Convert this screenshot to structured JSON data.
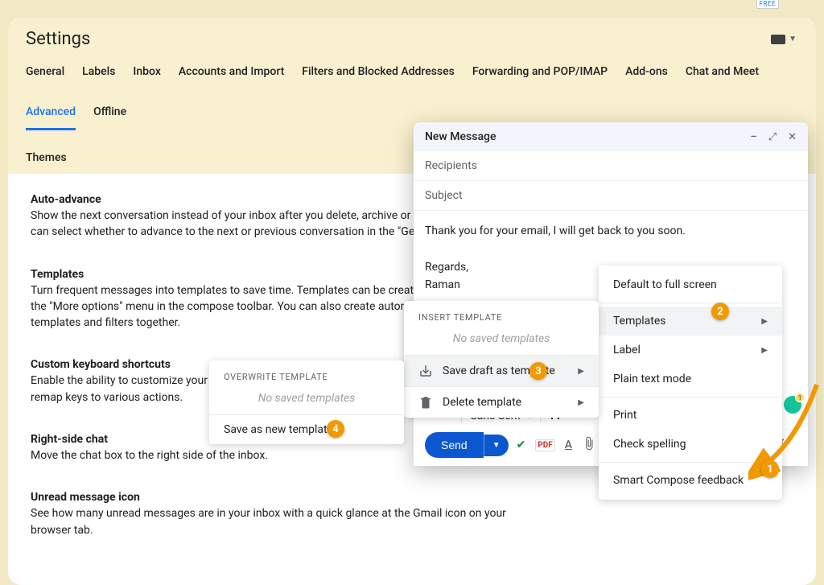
{
  "topbar": {
    "free_badge": "FREE"
  },
  "settings": {
    "title": "Settings",
    "tabs": {
      "general": "General",
      "labels": "Labels",
      "inbox": "Inbox",
      "accounts": "Accounts and Import",
      "filters": "Filters and Blocked Addresses",
      "forwarding": "Forwarding and POP/IMAP",
      "addons": "Add-ons",
      "chat": "Chat and Meet",
      "advanced": "Advanced",
      "offline": "Offline",
      "themes": "Themes"
    },
    "items": {
      "auto_advance": {
        "title": "Auto-advance",
        "desc": "Show the next conversation instead of your inbox after you delete, archive or mute a conversation. You can select whether to advance to the next or previous conversation in the \"General\" Settings page."
      },
      "templates": {
        "title": "Templates",
        "desc": "Turn frequent messages into templates to save time. Templates can be created and inserted through the \"More options\" menu in the compose toolbar. You can also create automatic replies using templates and filters together."
      },
      "custom_shortcuts": {
        "title": "Custom keyboard shortcuts",
        "desc": "Enable the ability to customize your keyboard shortcuts via a new settings tab from which you can remap keys to various actions."
      },
      "right_side_chat": {
        "title": "Right-side chat",
        "desc": "Move the chat box to the right side of the inbox."
      },
      "unread_icon": {
        "title": "Unread message icon",
        "desc": "See how many unread messages are in your inbox with a quick glance at the Gmail icon on your browser tab."
      }
    }
  },
  "compose": {
    "header": "New Message",
    "recipients_placeholder": "Recipients",
    "subject_placeholder": "Subject",
    "body_line1": "Thank you for your email, I will get back to you soon.",
    "body_regards": "Regards,",
    "body_name": "Raman",
    "font": "Sans Serif",
    "send": "Send",
    "pdf_label": "PDF"
  },
  "more_menu": {
    "default_fullscreen": "Default to full screen",
    "templates": "Templates",
    "label": "Label",
    "plain_text": "Plain text mode",
    "print": "Print",
    "check_spelling": "Check spelling",
    "smart_compose": "Smart Compose feedback"
  },
  "templates_submenu": {
    "insert_header": "INSERT TEMPLATE",
    "no_saved": "No saved templates",
    "save_draft": "Save draft as template",
    "delete": "Delete template"
  },
  "overwrite_submenu": {
    "header": "OVERWRITE TEMPLATE",
    "no_saved": "No saved templates",
    "save_new": "Save as new template"
  },
  "annotations": {
    "b1": "1",
    "b2": "2",
    "b3": "3",
    "b4": "4"
  },
  "grammarly_count": "1"
}
